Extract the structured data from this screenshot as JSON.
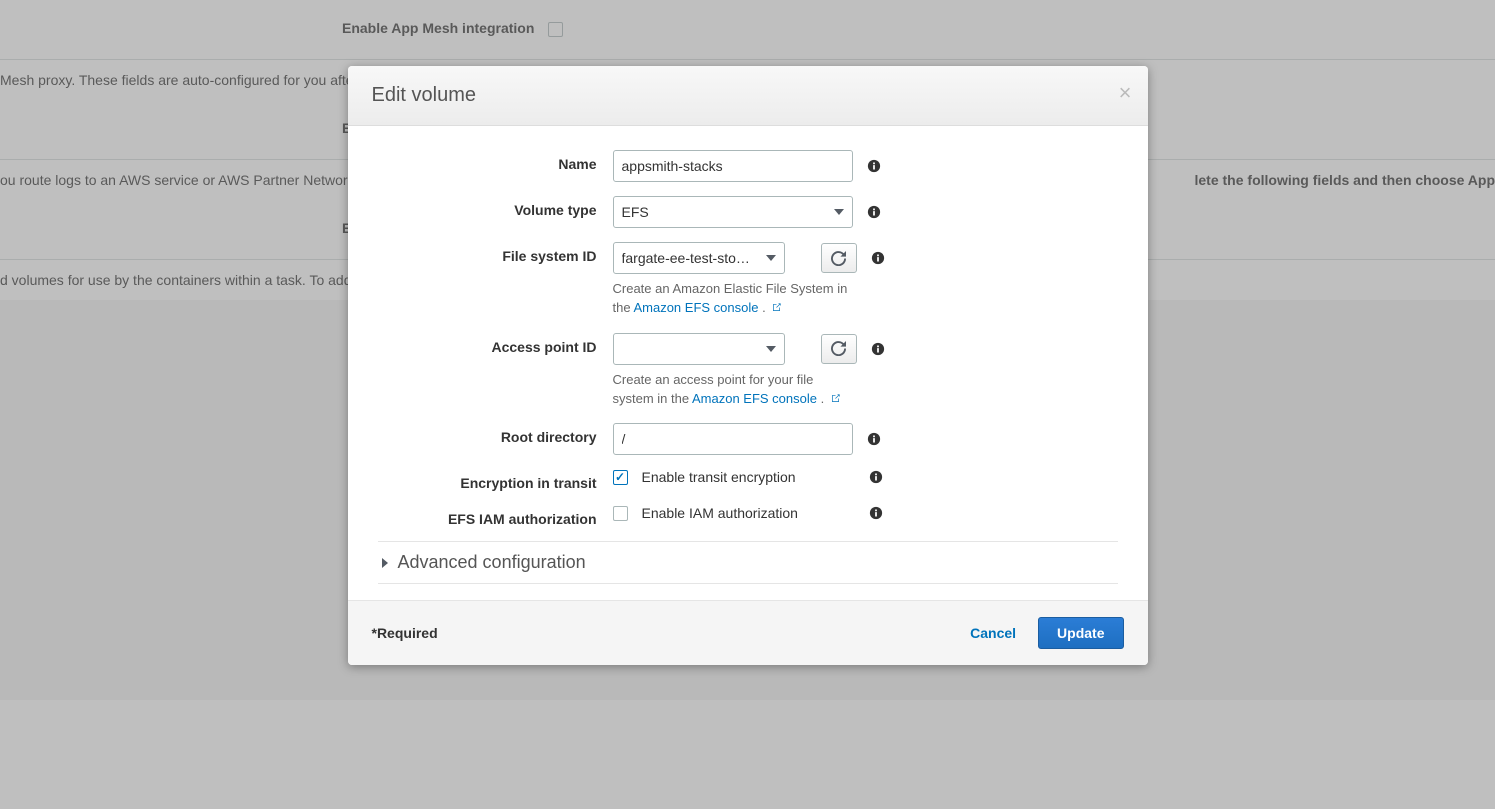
{
  "background": {
    "row1_label": "Enable App Mesh integration",
    "row1_help": "Mesh proxy. These fields are auto-configured for you after applying",
    "row2_label": "Enable p",
    "row2_help_prefix": "ou route logs to an AWS service or AWS Partner Network (APN) de",
    "row2_help_suffix": "lete the following fields and then choose App",
    "row3_label": "Enable Fi",
    "row3_help": "d volumes for use by the containers within a task. To add a volume"
  },
  "modal": {
    "title": "Edit volume",
    "fields": {
      "name": {
        "label": "Name",
        "value": "appsmith-stacks"
      },
      "volume_type": {
        "label": "Volume type",
        "value": "EFS"
      },
      "file_system_id": {
        "label": "File system ID",
        "value": "fargate-ee-test-sto…",
        "hint_prefix": "Create an Amazon Elastic File System in the ",
        "hint_link": "Amazon EFS console",
        "hint_suffix": "."
      },
      "access_point_id": {
        "label": "Access point ID",
        "value": "",
        "hint_prefix": "Create an access point for your file system in the ",
        "hint_link": "Amazon EFS console",
        "hint_suffix": "."
      },
      "root_directory": {
        "label": "Root directory",
        "value": "/"
      },
      "encryption": {
        "label": "Encryption in transit",
        "checked": true,
        "text": "Enable transit encryption"
      },
      "iam_auth": {
        "label": "EFS IAM authorization",
        "checked": false,
        "text": "Enable IAM authorization"
      }
    },
    "advanced_label": "Advanced configuration",
    "footer": {
      "required": "*Required",
      "cancel": "Cancel",
      "submit": "Update"
    }
  }
}
